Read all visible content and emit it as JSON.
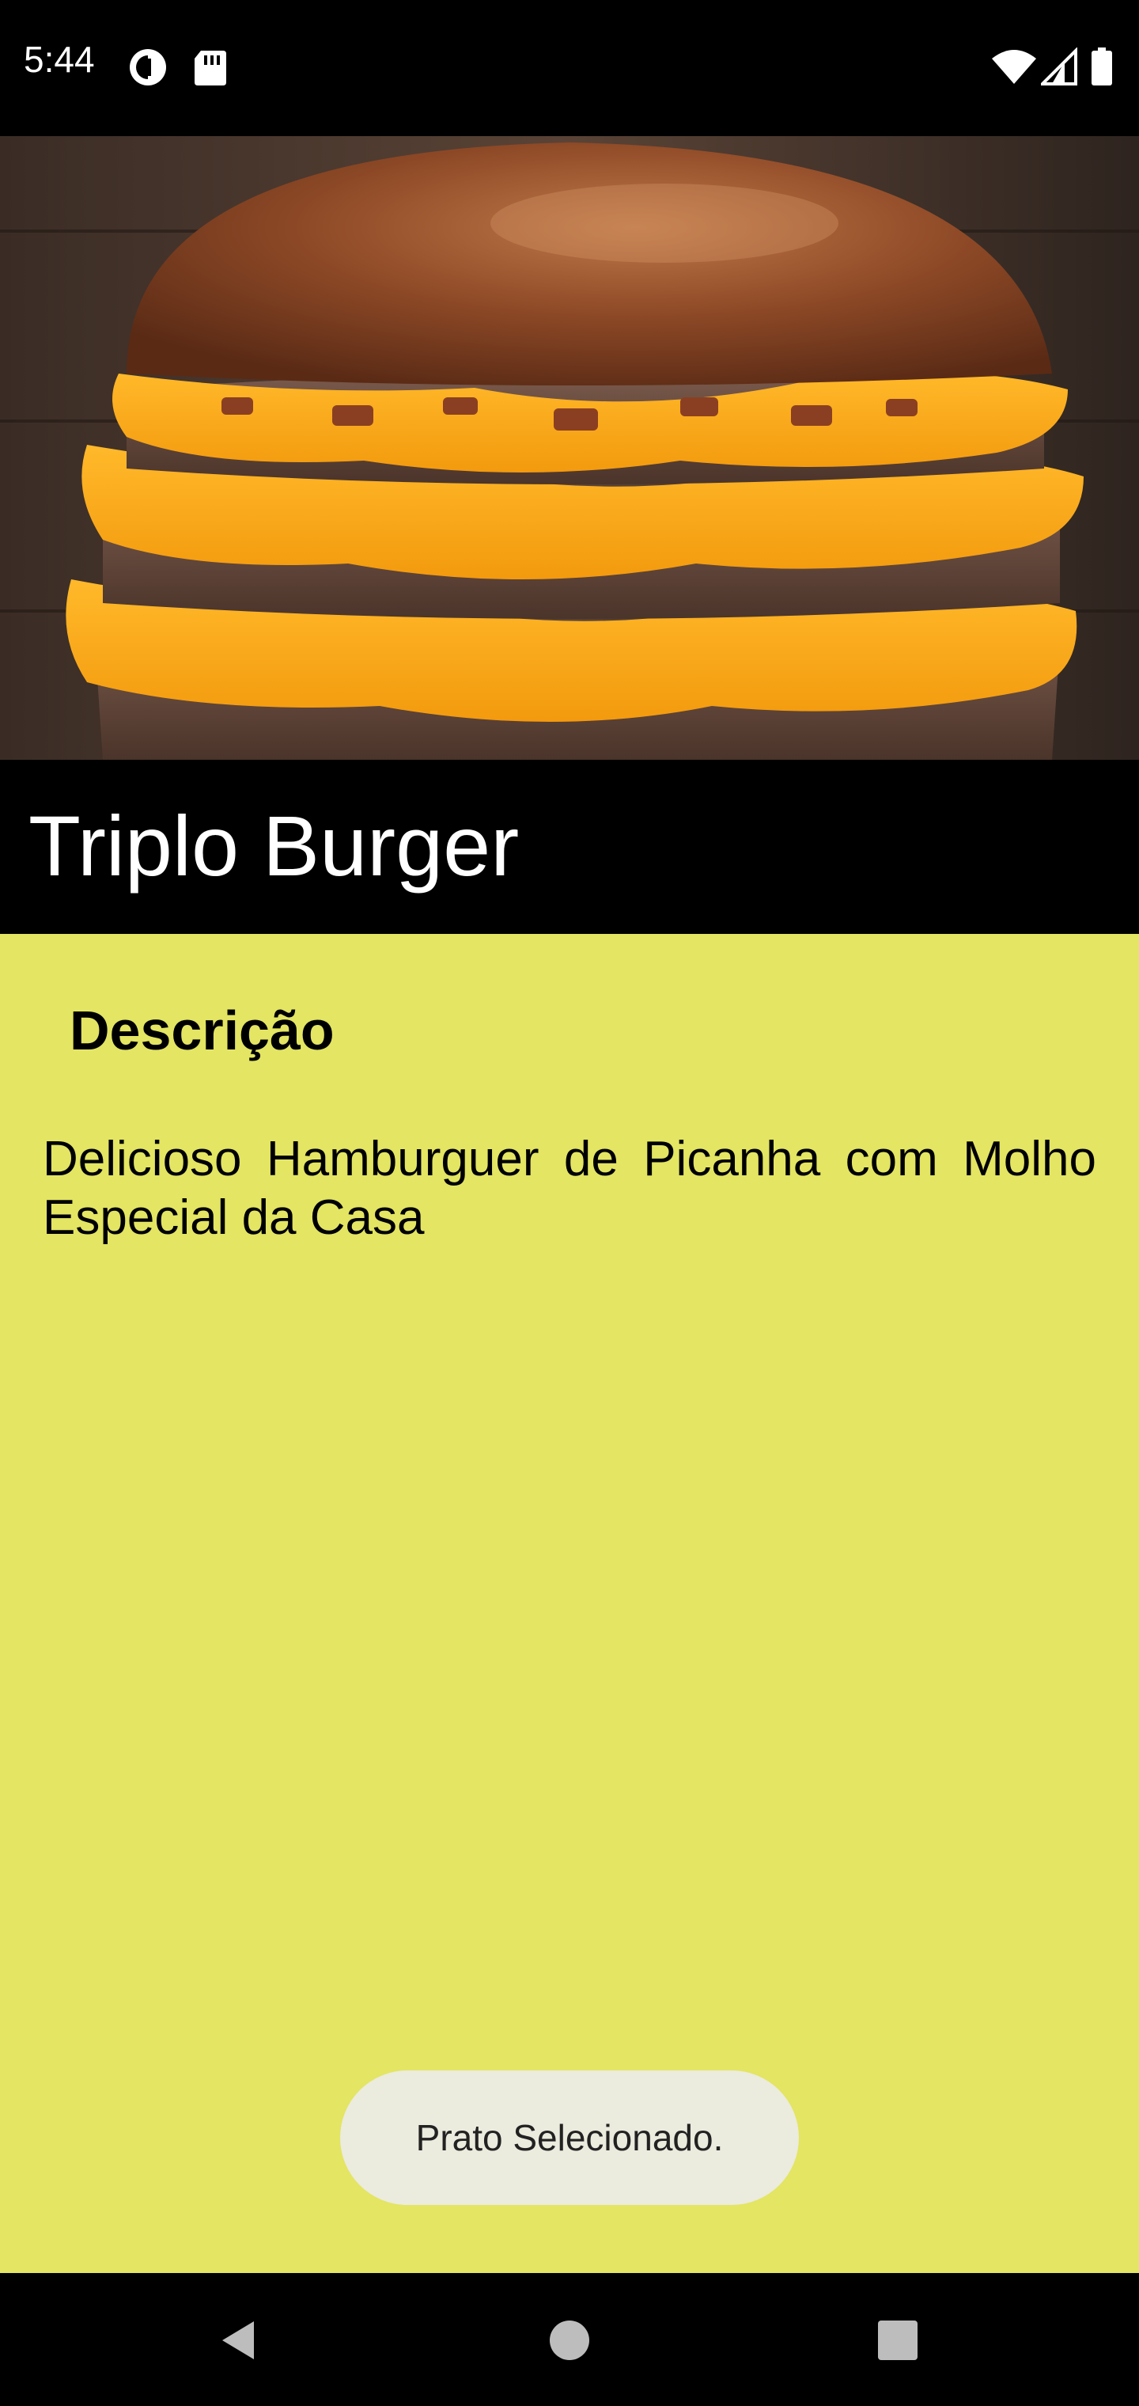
{
  "status_bar": {
    "time": "5:44",
    "left_icons": [
      "at-sign-icon",
      "sd-card-icon"
    ],
    "right_icons": [
      "wifi-icon",
      "cell-signal-icon",
      "battery-icon"
    ]
  },
  "hero": {
    "image_subject": "triple burger with cheese and bacon",
    "icon": "burger-photo"
  },
  "dish": {
    "title": "Triplo Burger"
  },
  "content": {
    "section_heading": "Descrição",
    "description": "Delicioso Hamburguer de Picanha com Molho Especial da Casa"
  },
  "toast": {
    "message": "Prato Selecionado."
  },
  "navigation": {
    "buttons": [
      "back-icon",
      "home-icon",
      "recents-icon"
    ]
  },
  "colors": {
    "content_background": "#e3e563",
    "title_band": "#000000",
    "toast_background": "#ebebde"
  }
}
